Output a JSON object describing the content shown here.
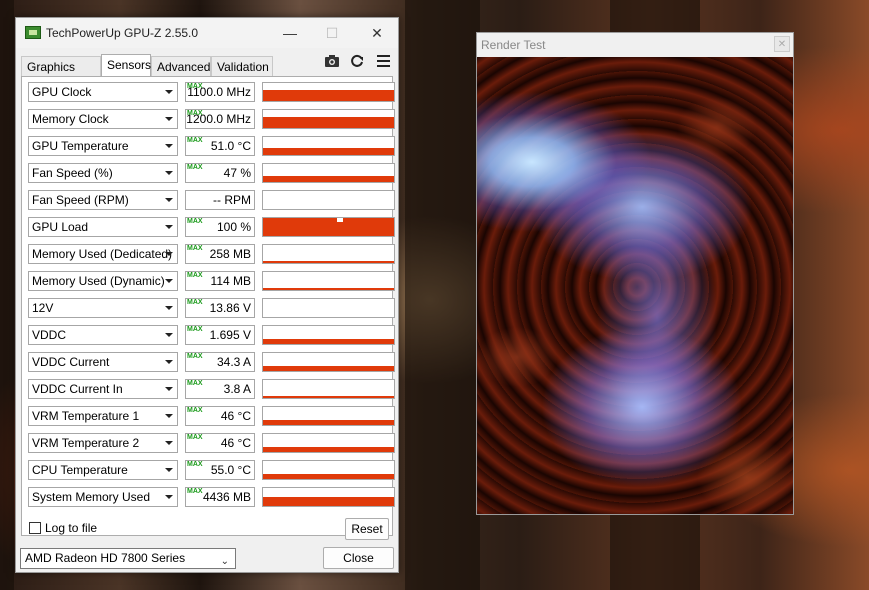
{
  "gpuz": {
    "title": "TechPowerUp GPU-Z 2.55.0",
    "tabs": [
      "Graphics Card",
      "Sensors",
      "Advanced",
      "Validation"
    ],
    "active_tab": "Sensors",
    "max_tag": "MAX",
    "sensors": [
      {
        "name": "GPU Clock",
        "value": "1100.0 MHz",
        "level": 0.6,
        "has_max": true
      },
      {
        "name": "Memory Clock",
        "value": "1200.0 MHz",
        "level": 0.6,
        "has_max": true
      },
      {
        "name": "GPU Temperature",
        "value": "51.0 °C",
        "level": 0.4,
        "has_max": true
      },
      {
        "name": "Fan Speed (%)",
        "value": "47 %",
        "level": 0.35,
        "has_max": true
      },
      {
        "name": "Fan Speed (RPM)",
        "value": "-- RPM",
        "level": 0,
        "has_max": false
      },
      {
        "name": "GPU Load",
        "value": "100 %",
        "level": 1.0,
        "has_max": true
      },
      {
        "name": "Memory Used (Dedicated)",
        "value": "258 MB",
        "level": 0.08,
        "has_max": true
      },
      {
        "name": "Memory Used (Dynamic)",
        "value": "114 MB",
        "level": 0.06,
        "has_max": true
      },
      {
        "name": "12V",
        "value": "13.86 V",
        "level": 0,
        "has_max": true
      },
      {
        "name": "VDDC",
        "value": "1.695 V",
        "level": 0.3,
        "has_max": true
      },
      {
        "name": "VDDC Current",
        "value": "34.3 A",
        "level": 0.25,
        "has_max": true
      },
      {
        "name": "VDDC Current In",
        "value": "3.8 A",
        "level": 0.06,
        "has_max": true
      },
      {
        "name": "VRM Temperature 1",
        "value": "46 °C",
        "level": 0.25,
        "has_max": true
      },
      {
        "name": "VRM Temperature 2",
        "value": "46 °C",
        "level": 0.25,
        "has_max": true
      },
      {
        "name": "CPU Temperature",
        "value": "55.0 °C",
        "level": 0.28,
        "has_max": true
      },
      {
        "name": "System Memory Used",
        "value": "4436 MB",
        "level": 0.5,
        "has_max": true
      }
    ],
    "log_to_file": "Log to file",
    "reset": "Reset",
    "device": "AMD Radeon HD 7800 Series",
    "close": "Close",
    "controls": {
      "minimize": "—",
      "maximize": "☐",
      "close": "✕"
    },
    "icons": [
      "camera-icon",
      "refresh-icon",
      "menu-icon"
    ]
  },
  "render_test": {
    "title": "Render Test"
  }
}
